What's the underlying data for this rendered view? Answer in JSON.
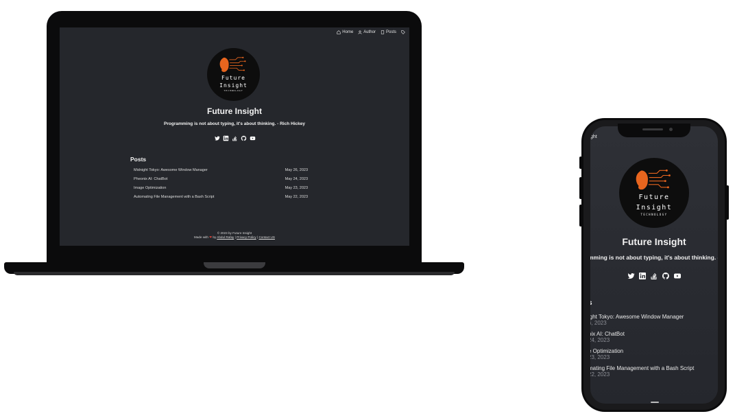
{
  "nav": {
    "home": "Home",
    "author": "Author",
    "posts": "Posts"
  },
  "logo": {
    "line1": "Future",
    "line2": "Insight",
    "line3": "TECHNOLOGY",
    "accent": "#e8651e"
  },
  "site": {
    "title": "Future Insight",
    "tagline": "Programming is not about typing, it's about thinking. - Rich Hickey"
  },
  "social": [
    "twitter-icon",
    "linkedin-icon",
    "stackoverflow-icon",
    "github-icon",
    "youtube-icon"
  ],
  "posts_heading": "Posts",
  "posts": [
    {
      "title": "Midnight Tokyo: Awesome Window Manager",
      "date": "May 26, 2023"
    },
    {
      "title": "Pheonix AI: ChatBot",
      "date": "May 24, 2023"
    },
    {
      "title": "Image Optimization",
      "date": "May 23, 2023"
    },
    {
      "title": "Automating File Management with a Bash Script",
      "date": "May 22, 2023"
    }
  ],
  "footer": {
    "copyright": "© 2023 by Future Insight",
    "made_with": "Made with",
    "by": "by",
    "author_link": "Abdul Rafay",
    "privacy_link": "Privacy Policy",
    "contact_link": "Contact US",
    "heart_color": "#e0453a"
  },
  "phone": {
    "nav_fragment": "ght",
    "tagline_fragment": "mming is not about typing, it's about thinking. - Ric",
    "posts_heading_fragment": "s",
    "posts": [
      {
        "title": "ight Tokyo: Awesome Window Manager",
        "date": "6, 2023"
      },
      {
        "title": "nix AI: ChatBot",
        "date": "24, 2023"
      },
      {
        "title": "e Optimization",
        "date": "23, 2023"
      },
      {
        "title": "mating File Management with a Bash Script",
        "date": "22, 2023"
      }
    ]
  }
}
